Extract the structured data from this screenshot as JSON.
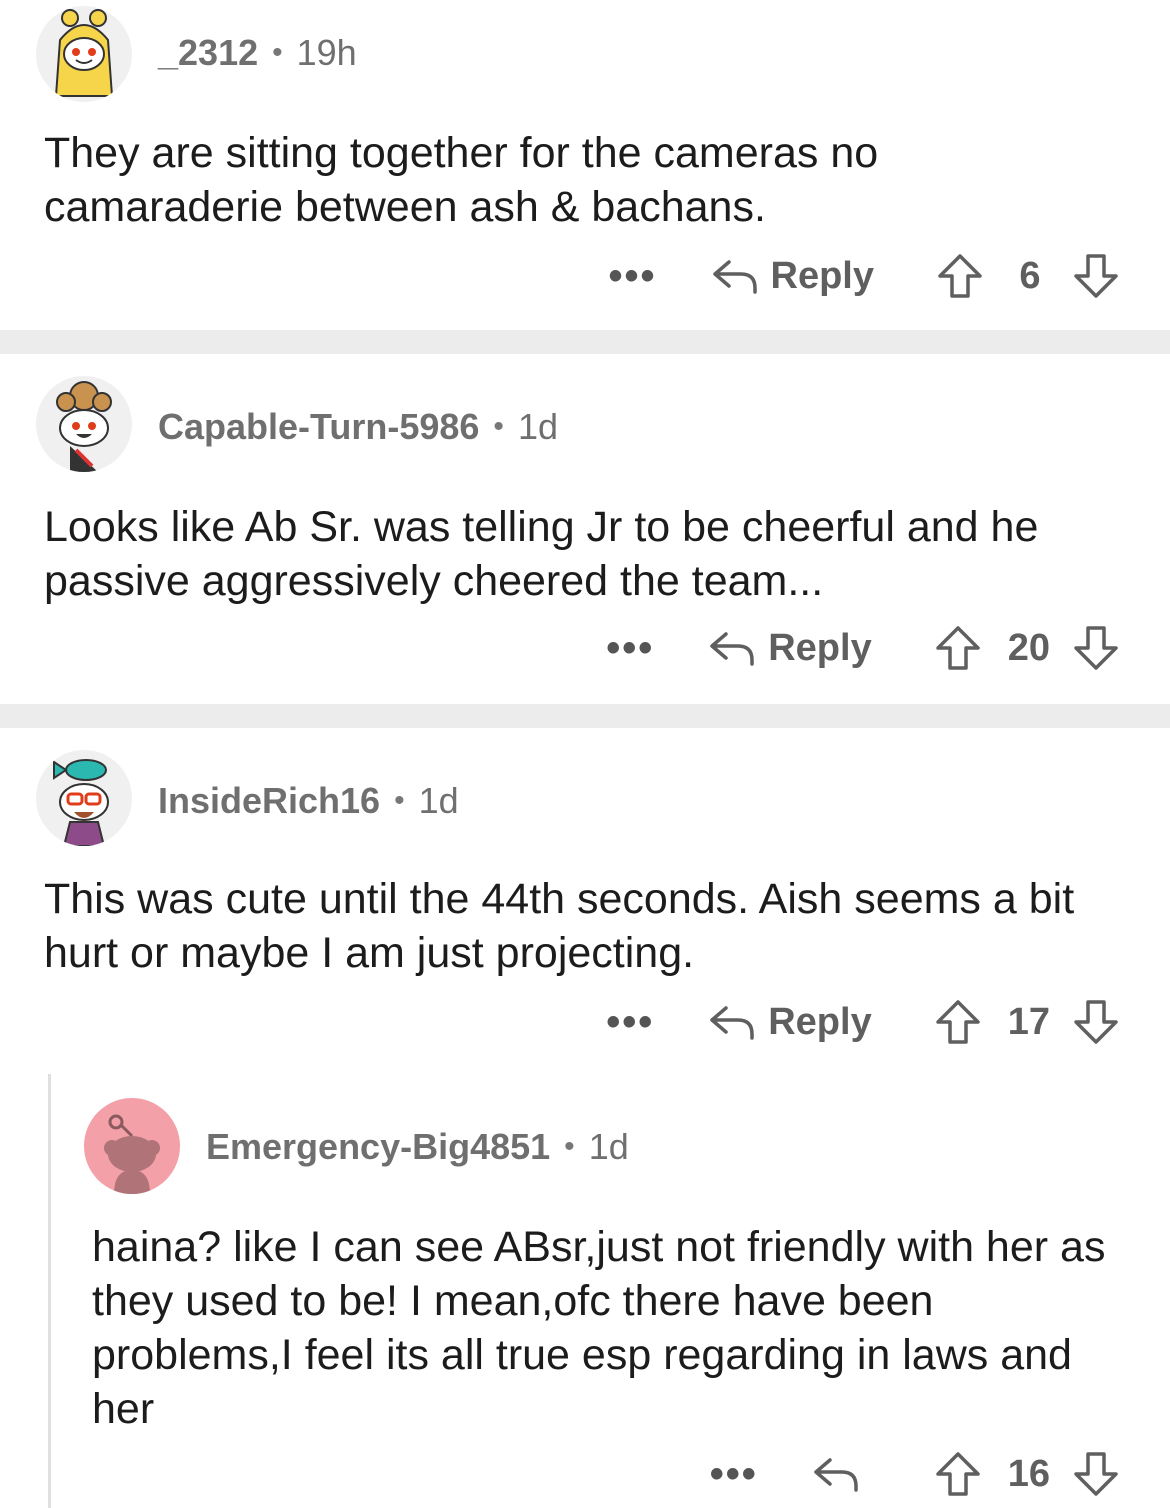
{
  "comments": [
    {
      "username": "_2312",
      "time": "19h",
      "body": "They are sitting together for the cameras no camaraderie between ash & bachans.",
      "more": "•••",
      "reply_label": "Reply",
      "score": "6",
      "avatar_icon": "yellow-snoo-avatar-icon"
    },
    {
      "username": "Capable-Turn-5986",
      "time": "1d",
      "body": "Looks like Ab Sr. was telling Jr to be cheerful and he passive aggressively cheered the team...",
      "more": "•••",
      "reply_label": "Reply",
      "score": "20",
      "avatar_icon": "bun-hair-snoo-avatar-icon"
    },
    {
      "username": "InsideRich16",
      "time": "1d",
      "body": "This was cute until the 44th seconds. Aish seems a bit hurt or maybe I am just projecting.",
      "more": "•••",
      "reply_label": "Reply",
      "score": "17",
      "avatar_icon": "fish-hat-snoo-avatar-icon"
    },
    {
      "username": "Emergency-Big4851",
      "time": "1d",
      "body": "haina? like I can see ABsr,just not friendly with her as they used to be! I mean,ofc there have been problems,I feel its all true esp regarding in laws and her",
      "more": "•••",
      "reply_label": "",
      "score": "16",
      "avatar_icon": "default-snoo-avatar-icon"
    }
  ],
  "dot": "•",
  "colors": {
    "divider": "#ececec",
    "meta_text": "#6f6f6f",
    "body_text": "#1c1c1c",
    "default_avatar_bg": "#f4a0a8"
  }
}
